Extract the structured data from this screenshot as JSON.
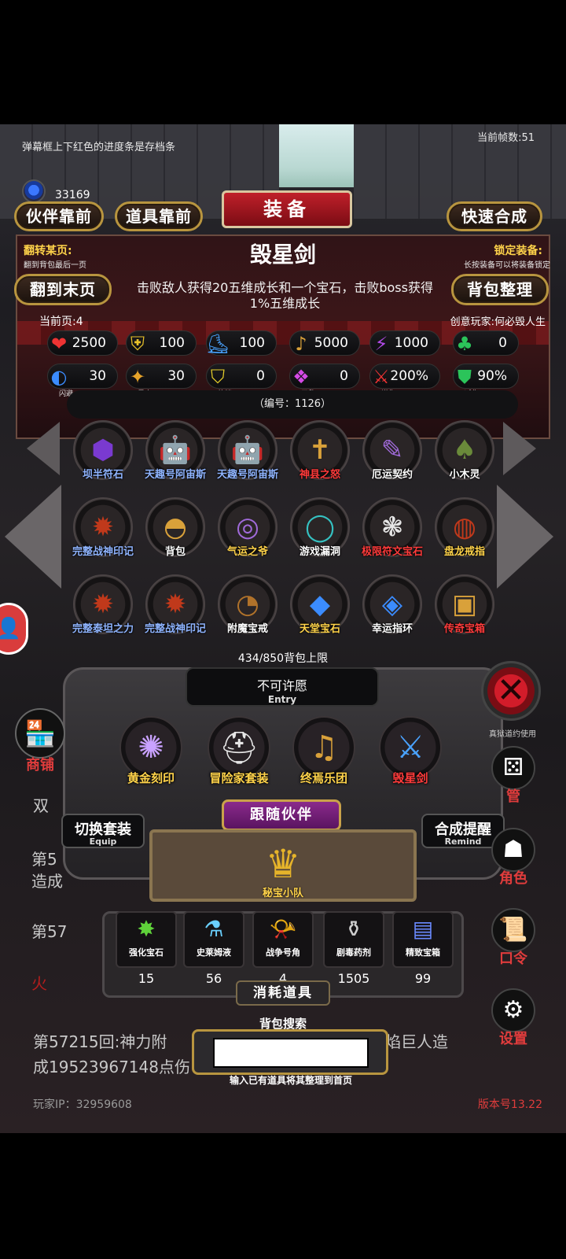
{
  "hud": {
    "hint": "弹幕框上下红色的进度条是存档条",
    "fps": "当前帧数:51",
    "gem_count": "33169"
  },
  "top_buttons": {
    "partner_front": "伙伴靠前",
    "item_front": "道具靠前",
    "quick_merge": "快速合成",
    "title": "装备"
  },
  "info": {
    "flip_label": "翻转某页:",
    "flip_sub": "翻到背包最后一页",
    "lock_label": "锁定装备:",
    "lock_sub": "长按装备可以将装备锁定",
    "flip_last": "翻到末页",
    "sort_bag": "背包整理",
    "item_name": "毁星剑",
    "item_desc": "击败敌人获得20五维成长和一个宝石，击败boss获得1%五维成长",
    "current_page": "当前页:4",
    "creator": "创意玩家:何必毁人生"
  },
  "stats": [
    {
      "icon": "heart-icon",
      "glyph": "❤",
      "color": "#e33",
      "value": "2500",
      "label": ""
    },
    {
      "icon": "armor-icon",
      "glyph": "⛨",
      "color": "#e8c22a",
      "value": "100",
      "label": ""
    },
    {
      "icon": "boot-icon",
      "glyph": "⛸",
      "color": "#4aa3ff",
      "value": "100",
      "label": ""
    },
    {
      "icon": "lute-icon",
      "glyph": "♪",
      "color": "#d9a13a",
      "value": "5000",
      "label": ""
    },
    {
      "icon": "lightning-icon",
      "glyph": "⚡",
      "color": "#b04ae6",
      "value": "1000",
      "label": ""
    },
    {
      "icon": "clover-icon",
      "glyph": "♣",
      "color": "#2bc45a",
      "value": "0",
      "label": ""
    },
    {
      "icon": "dodge-icon",
      "glyph": "◐",
      "color": "#3b8cff",
      "value": "30",
      "label": "闪避"
    },
    {
      "icon": "crit-icon",
      "glyph": "✦",
      "color": "#e6a32a",
      "value": "30",
      "label": "暴击"
    },
    {
      "icon": "block-icon",
      "glyph": "⛉",
      "color": "#e8d02a",
      "value": "0",
      "label": "格挡"
    },
    {
      "icon": "invincible-icon",
      "glyph": "❖",
      "color": "#d44ae6",
      "value": "0",
      "label": "无敌"
    },
    {
      "icon": "damage-up-icon",
      "glyph": "⚔",
      "color": "#e33",
      "value": "200%",
      "label": "增伤"
    },
    {
      "icon": "damage-reduce-icon",
      "glyph": "⛊",
      "color": "#2bc45a",
      "value": "90%",
      "label": "减伤"
    }
  ],
  "code": "（编号：1126）",
  "inventory": [
    {
      "name": "坝半符石",
      "color": "#8fb4ff",
      "glyph": "⬢",
      "gcolor": "#7a3ad0"
    },
    {
      "name": "天趣号阿宙斯",
      "color": "#8fb4ff",
      "glyph": "🤖",
      "gcolor": "#ccc"
    },
    {
      "name": "天趣号阿宙斯",
      "color": "#8fb4ff",
      "glyph": "🤖",
      "gcolor": "#ccc"
    },
    {
      "name": "神县之怒",
      "color": "#ff3b3b",
      "glyph": "✝",
      "gcolor": "#d9a13a"
    },
    {
      "name": "厄运契约",
      "color": "#ffffff",
      "glyph": "✎",
      "gcolor": "#a06ad9"
    },
    {
      "name": "小木灵",
      "color": "#ffffff",
      "glyph": "♠",
      "gcolor": "#6a8a3a"
    },
    {
      "name": "完整战神印记",
      "color": "#8fb4ff",
      "glyph": "✹",
      "gcolor": "#c0391b"
    },
    {
      "name": "背包",
      "color": "#ffffff",
      "glyph": "◓",
      "gcolor": "#d9a13a"
    },
    {
      "name": "气运之爷",
      "color": "#ffd34a",
      "glyph": "◎",
      "gcolor": "#a06ad9"
    },
    {
      "name": "游戏漏洞",
      "color": "#ffffff",
      "glyph": "◯",
      "gcolor": "#35c1c1"
    },
    {
      "name": "极限符文宝石",
      "color": "#ff3b3b",
      "glyph": "❃",
      "gcolor": "#e6e6e6"
    },
    {
      "name": "盘龙戒指",
      "color": "#ffd34a",
      "glyph": "◍",
      "gcolor": "#c0391b"
    },
    {
      "name": "完整泰坦之力",
      "color": "#8fb4ff",
      "glyph": "✹",
      "gcolor": "#c0391b"
    },
    {
      "name": "完整战神印记",
      "color": "#8fb4ff",
      "glyph": "✹",
      "gcolor": "#c0391b"
    },
    {
      "name": "附魔宝戒",
      "color": "#ffffff",
      "glyph": "◔",
      "gcolor": "#b0722a"
    },
    {
      "name": "天堂宝石",
      "color": "#ffd34a",
      "glyph": "◆",
      "gcolor": "#3b8cff"
    },
    {
      "name": "幸运指环",
      "color": "#ffffff",
      "glyph": "◈",
      "gcolor": "#3b8cff"
    },
    {
      "name": "传奇宝箱",
      "color": "#ff3b3b",
      "glyph": "▣",
      "gcolor": "#d9a13a"
    }
  ],
  "capacity": "434/850背包上限",
  "entry": {
    "title": "不可许愿",
    "sub": "Entry"
  },
  "equipped": [
    {
      "name": "黄金刻印",
      "color": "#ffd34a",
      "glyph": "✺",
      "gcolor": "#c9a2ff"
    },
    {
      "name": "冒险家套装",
      "color": "#ffd34a",
      "glyph": "⛑",
      "gcolor": "#e6e6e6"
    },
    {
      "name": "终焉乐团",
      "color": "#ffd34a",
      "glyph": "♫",
      "gcolor": "#d9a13a"
    },
    {
      "name": "毁星剑",
      "color": "#ff3b3b",
      "glyph": "⚔",
      "gcolor": "#4aa3ff"
    }
  ],
  "follow": {
    "ribbon": "跟随伙伴",
    "switch_set": "切换套装",
    "switch_sub": "Equip",
    "merge_remind": "合成提醒",
    "merge_sub": "Remind",
    "companion_name": "秘宝小队"
  },
  "consumables": [
    {
      "name": "强化宝石",
      "count": "15",
      "glyph": "✸",
      "gcolor": "#5fd23a"
    },
    {
      "name": "史莱姆液",
      "count": "56",
      "glyph": "⚗",
      "gcolor": "#6ad0ff"
    },
    {
      "name": "战争号角",
      "count": "4",
      "glyph": "📯",
      "gcolor": "#b06ad9"
    },
    {
      "name": "剧毒药剂",
      "count": "1505",
      "glyph": "⚱",
      "gcolor": "#cfcfcf"
    },
    {
      "name": "精致宝箱",
      "count": "99",
      "glyph": "▤",
      "gcolor": "#6a8aff"
    }
  ],
  "consumables_title": "消耗道具",
  "search": {
    "title": "背包搜索",
    "placeholder": "",
    "hint": "输入已有道具将其整理到首页"
  },
  "log": {
    "line1a": "双",
    "line2a": "第5",
    "line2b": "造成",
    "line3a": "第57",
    "line4a": "火",
    "line5a": "第57215回:神力附",
    "line5b": "焰巨人造",
    "line6a": "成19523967148点伤"
  },
  "nav": {
    "shop": "商铺",
    "manage": "管",
    "role": "角色",
    "password": "口令",
    "settings": "设置",
    "close_hint": "真狱道约使用"
  },
  "footer": {
    "player_ip": "玩家IP：32959608",
    "version": "版本号13.22"
  }
}
